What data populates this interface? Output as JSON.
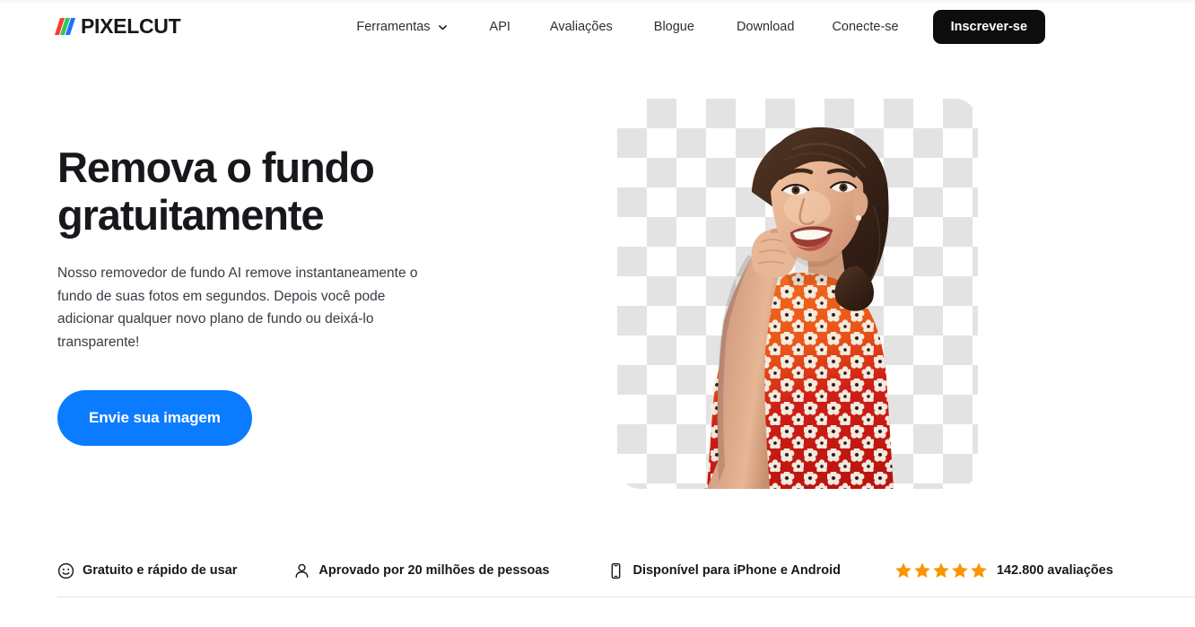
{
  "brand": {
    "name": "PIXELCUT",
    "logo_colors": [
      "#ff3b30",
      "#34c759",
      "#1a73ff"
    ]
  },
  "nav": {
    "items": [
      {
        "label": "Ferramentas",
        "has_dropdown": true,
        "icon": "chevron-down-icon"
      },
      {
        "label": "API",
        "has_dropdown": false
      },
      {
        "label": "Avaliações",
        "has_dropdown": false
      },
      {
        "label": "Blogue",
        "has_dropdown": false
      },
      {
        "label": "Download",
        "has_dropdown": false
      },
      {
        "label": "Conecte-se",
        "has_dropdown": false
      }
    ],
    "signup_label": "Inscrever-se",
    "signup_bg": "#0d0d0f"
  },
  "hero": {
    "title": "Remova o fundo\ngratuitamente",
    "subtitle": "Nosso removedor de fundo AI remove instantaneamente o fundo de suas fotos em segundos. Depois você pode adicionar qualquer novo plano de fundo ou deixá-lo transparente!",
    "cta_label": "Envie sua imagem",
    "cta_bg": "#0b7cff",
    "image_alt": "Mulher sorrindo com vestido floral vermelho e laranja sobre fundo transparente quadriculado"
  },
  "features": [
    {
      "icon": "smiley-face-icon",
      "label": "Gratuito e rápido de usar"
    },
    {
      "icon": "person-icon",
      "label": "Aprovado por 20 milhões de pessoas"
    },
    {
      "icon": "smartphone-icon",
      "label": "Disponível para iPhone e Android"
    }
  ],
  "rating": {
    "stars": 5,
    "star_color": "#fa9500",
    "count_label": "142.800 avaliações"
  }
}
